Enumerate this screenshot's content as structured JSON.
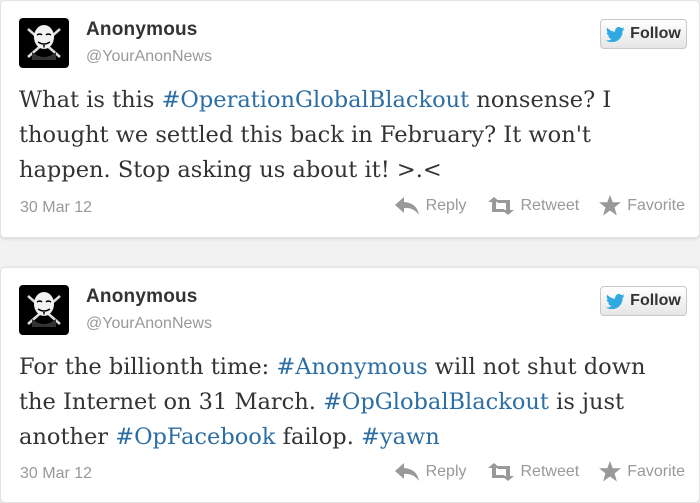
{
  "tweets": [
    {
      "name": "Anonymous",
      "handle": "@YourAnonNews",
      "follow_label": "Follow",
      "text_parts": [
        {
          "t": "What is this ",
          "tag": false
        },
        {
          "t": "#OperationGlobalBlackout",
          "tag": true
        },
        {
          "t": " nonsense? I thought we settled this back in February? It won't happen. Stop asking us about it! >.<",
          "tag": false
        }
      ],
      "date": "30 Mar 12",
      "reply_label": "Reply",
      "retweet_label": "Retweet",
      "favorite_label": "Favorite"
    },
    {
      "name": "Anonymous",
      "handle": "@YourAnonNews",
      "follow_label": "Follow",
      "text_parts": [
        {
          "t": "For the billionth time: ",
          "tag": false
        },
        {
          "t": "#Anonymous",
          "tag": true
        },
        {
          "t": " will not shut down the Internet on 31 March. ",
          "tag": false
        },
        {
          "t": "#OpGlobalBlackout",
          "tag": true
        },
        {
          "t": " is just another ",
          "tag": false
        },
        {
          "t": "#OpFacebook",
          "tag": true
        },
        {
          "t": " failop. ",
          "tag": false
        },
        {
          "t": "#yawn",
          "tag": true
        }
      ],
      "date": "30 Mar 12",
      "reply_label": "Reply",
      "retweet_label": "Retweet",
      "favorite_label": "Favorite"
    }
  ],
  "colors": {
    "hashtag": "#2c6ea3",
    "twitter_bird": "#2fa9e0",
    "muted": "#999999"
  },
  "icons": [
    "anonymous-avatar",
    "twitter-bird-icon",
    "reply-arrow-icon",
    "retweet-icon",
    "star-icon"
  ]
}
